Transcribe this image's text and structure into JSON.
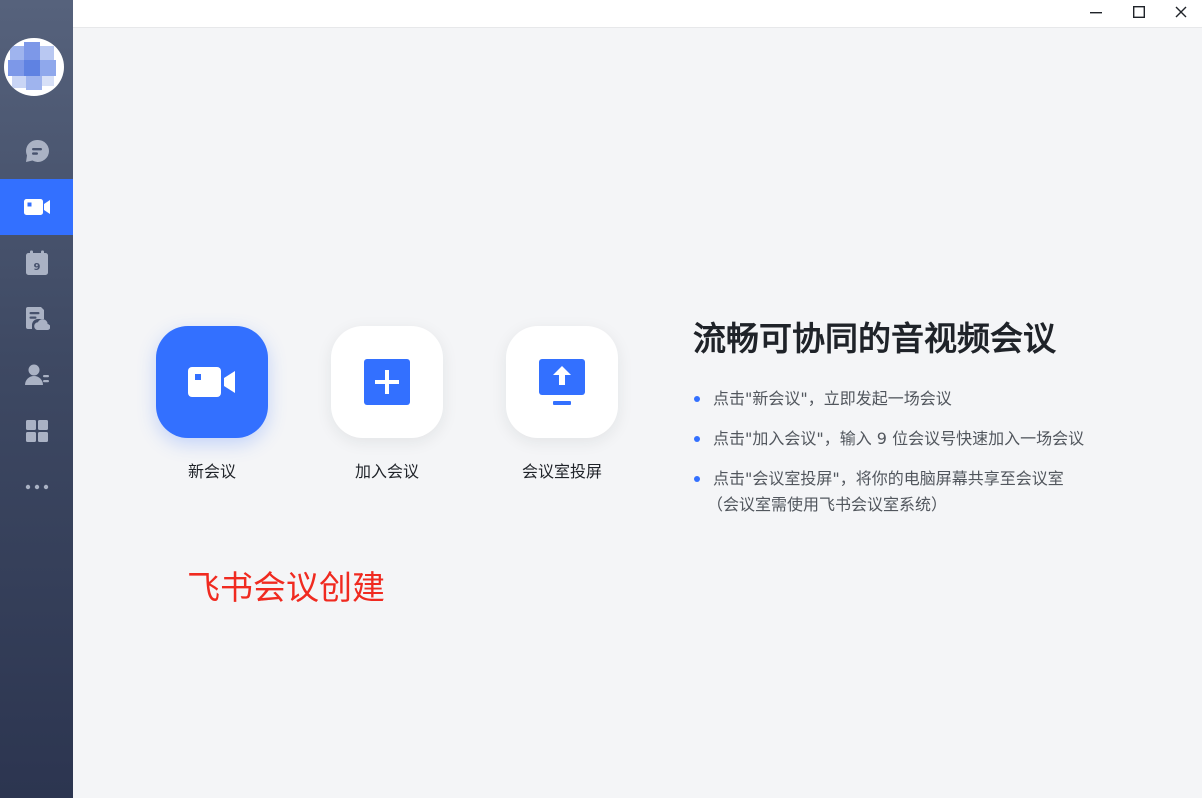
{
  "window": {
    "minimize_icon": "minimize-icon",
    "maximize_icon": "maximize-icon",
    "close_icon": "close-icon"
  },
  "sidebar": {
    "items": [
      {
        "id": "messages",
        "icon": "chat-bubble-icon",
        "active": false
      },
      {
        "id": "video-meeting",
        "icon": "video-camera-icon",
        "active": true
      },
      {
        "id": "calendar",
        "icon": "calendar-icon",
        "active": false
      },
      {
        "id": "docs",
        "icon": "cloud-doc-icon",
        "active": false
      },
      {
        "id": "contacts",
        "icon": "contacts-icon",
        "active": false
      },
      {
        "id": "workplace",
        "icon": "apps-grid-icon",
        "active": false
      },
      {
        "id": "more",
        "icon": "more-dots-icon",
        "active": false
      }
    ]
  },
  "actions": [
    {
      "id": "new-meeting",
      "label": "新会议",
      "icon": "video-camera-icon"
    },
    {
      "id": "join-meeting",
      "label": "加入会议",
      "icon": "plus-icon"
    },
    {
      "id": "room-share",
      "label": "会议室投屏",
      "icon": "screen-share-icon"
    }
  ],
  "info": {
    "headline": "流畅可协同的音视频会议",
    "tips": [
      {
        "text": "点击\"新会议\"，立即发起一场会议"
      },
      {
        "text": "点击\"加入会议\"，输入 9 位会议号快速加入一场会议"
      },
      {
        "text": "点击\"会议室投屏\"，将你的电脑屏幕共享至会议室",
        "sub": "（会议室需使用飞书会议室系统）"
      }
    ]
  },
  "annotation": "飞书会议创建",
  "colors": {
    "accent": "#3370ff",
    "annotation": "#f02a20",
    "background": "#f4f5f7"
  }
}
